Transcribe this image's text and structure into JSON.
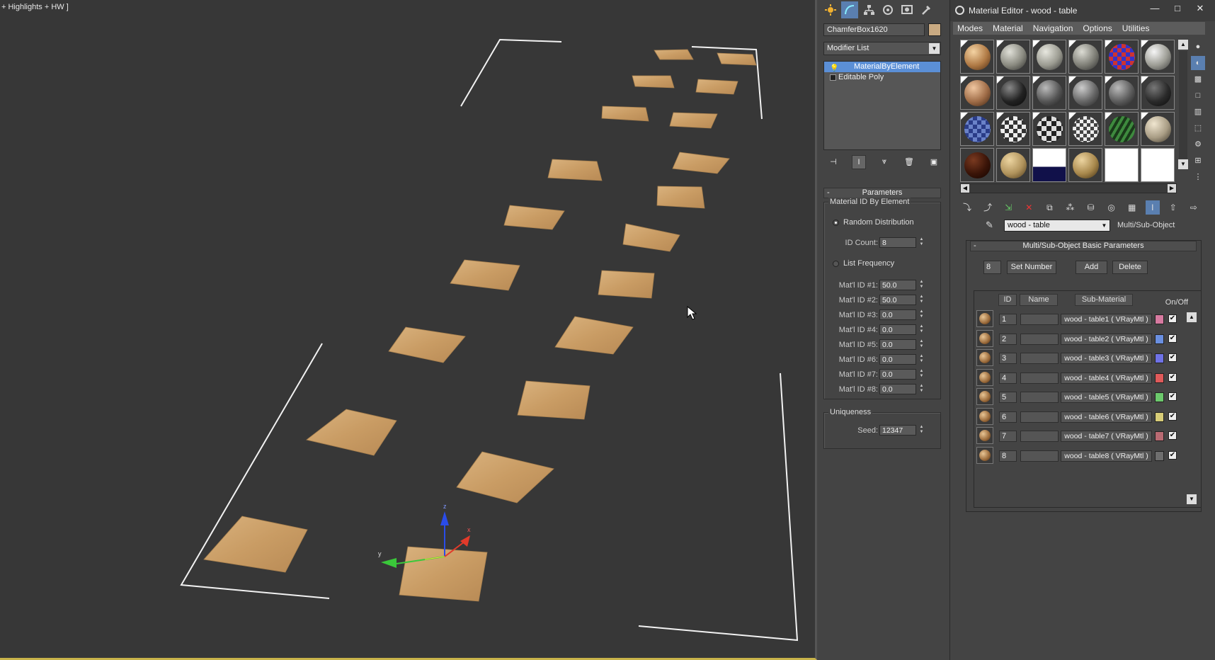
{
  "viewport": {
    "label": "+ Highlights + HW ]",
    "gizmo": {
      "x": "x",
      "y": "y",
      "z": "z"
    }
  },
  "command_panel": {
    "tabs": [
      "create-icon",
      "modify-icon",
      "hierarchy-icon",
      "motion-icon",
      "display-icon",
      "utilities-icon"
    ],
    "object_name": "ChamferBox1620",
    "object_color": "#c9aa82",
    "modifier_list": "Modifier List",
    "stack": [
      {
        "label": "MaterialByElement",
        "selected": true
      },
      {
        "label": "Editable Poly",
        "selected": false
      }
    ],
    "stack_tools": [
      "pin-stack-icon",
      "show-end-result-icon",
      "make-unique-icon",
      "remove-modifier-icon",
      "configure-sets-icon"
    ],
    "parameters": {
      "header": "Parameters",
      "group_title": "Material ID By Element",
      "random_distribution": "Random Distribution",
      "id_count_label": "ID Count:",
      "id_count": "8",
      "list_frequency": "List Frequency",
      "mat_ids": [
        {
          "label": "Mat'l ID #1:",
          "value": "50.0"
        },
        {
          "label": "Mat'l ID #2:",
          "value": "50.0"
        },
        {
          "label": "Mat'l ID #3:",
          "value": "0.0"
        },
        {
          "label": "Mat'l ID #4:",
          "value": "0.0"
        },
        {
          "label": "Mat'l ID #5:",
          "value": "0.0"
        },
        {
          "label": "Mat'l ID #6:",
          "value": "0.0"
        },
        {
          "label": "Mat'l ID #7:",
          "value": "0.0"
        },
        {
          "label": "Mat'l ID #8:",
          "value": "0.0"
        }
      ],
      "uniqueness_title": "Uniqueness",
      "seed_label": "Seed:",
      "seed": "12347"
    }
  },
  "material_editor": {
    "title": "Material Editor - wood - table",
    "window_buttons": [
      "—",
      "□",
      "✕"
    ],
    "menu": [
      "Modes",
      "Material",
      "Navigation",
      "Options",
      "Utilities"
    ],
    "material_name": "wood - table",
    "material_type": "Multi/Sub-Object",
    "panel_title": "Multi/Sub-Object Basic Parameters",
    "set_number_value": "8",
    "set_number_label": "Set Number",
    "add_label": "Add",
    "delete_label": "Delete",
    "columns": {
      "id": "ID",
      "name": "Name",
      "sub_material": "Sub-Material",
      "on_off": "On/Off"
    },
    "sub_materials": [
      {
        "id": "1",
        "name": "",
        "material": "wood - table1  ( VRayMtl )",
        "color": "#d77aa0",
        "on": true
      },
      {
        "id": "2",
        "name": "",
        "material": "wood - table2  ( VRayMtl )",
        "color": "#6a8fe0",
        "on": true
      },
      {
        "id": "3",
        "name": "",
        "material": "wood - table3  ( VRayMtl )",
        "color": "#6f72e6",
        "on": true
      },
      {
        "id": "4",
        "name": "",
        "material": "wood - table4  ( VRayMtl )",
        "color": "#e05a5a",
        "on": true
      },
      {
        "id": "5",
        "name": "",
        "material": "wood - table5  ( VRayMtl )",
        "color": "#6cc96c",
        "on": true
      },
      {
        "id": "6",
        "name": "",
        "material": "wood - table6  ( VRayMtl )",
        "color": "#d7cc77",
        "on": true
      },
      {
        "id": "7",
        "name": "",
        "material": "wood - table7  ( VRayMtl )",
        "color": "#b86a72",
        "on": true
      },
      {
        "id": "8",
        "name": "",
        "material": "wood - table8  ( VRayMtl )",
        "color": "#6e6e6e",
        "on": true
      }
    ]
  }
}
